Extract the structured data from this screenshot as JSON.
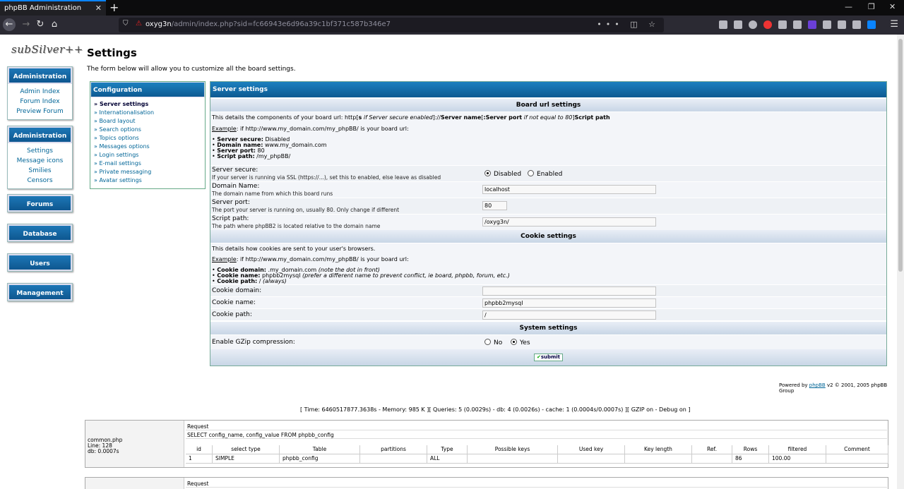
{
  "browser": {
    "tab_title": "phpBB Administration",
    "url_host": "oxyg3n",
    "url_path": "/admin/index.php?sid=fc66943e6d96a39c1bf371c587b346e7",
    "tab_close": "✕",
    "new_tab": "+",
    "win_min": "—",
    "win_restore": "❐",
    "win_close": "✕",
    "more_dots": "•••"
  },
  "logo_text": "subSilver++",
  "nav": {
    "admin1": {
      "title": "Administration",
      "links": [
        "Admin Index",
        "Forum Index",
        "Preview Forum"
      ]
    },
    "admin2": {
      "title": "Administration",
      "links": [
        "Settings",
        "Message icons",
        "Smilies",
        "Censors"
      ]
    },
    "forums": "Forums",
    "database": "Database",
    "users": "Users",
    "management": "Management"
  },
  "page": {
    "title": "Settings",
    "intro": "The form below will allow you to customize all the board settings."
  },
  "config": {
    "title": "Configuration",
    "items": [
      "» Server settings",
      "» Internationalisation",
      "» Board layout",
      "» Search options",
      "» Topics options",
      "» Messages options",
      "» Login settings",
      "» E-mail settings",
      "» Private messaging",
      "» Avatar settings"
    ]
  },
  "server": {
    "title": "Server settings",
    "board_url_header": "Board url settings",
    "board_desc_1": "This details the components of your board url: http[",
    "board_desc_s": "s",
    "board_desc_if": " if Server secure enabled",
    "board_desc_2": "]://",
    "board_desc_sn": "Server name",
    "board_desc_3": "[",
    "board_desc_sp": ":Server port",
    "board_desc_if2": " if not equal to 80",
    "board_desc_4": "]",
    "board_desc_path": "Script path",
    "example_label": "Example",
    "example_text": ": if http://www.my_domain.com/my_phpBB/ is your board url:",
    "bullets": [
      {
        "k": "Server secure:",
        "v": " Disabled"
      },
      {
        "k": "Domain name:",
        "v": " www.my_domain.com"
      },
      {
        "k": "Server port:",
        "v": " 80"
      },
      {
        "k": "Script path:",
        "v": " /my_phpBB/"
      }
    ],
    "secure_label": "Server secure:",
    "secure_sub": "If your server is running via SSL (https://...), set this to enabled, else leave as disabled",
    "secure_opt1": "Disabled",
    "secure_opt2": "Enabled",
    "domain_label": "Domain Name:",
    "domain_sub": "The domain name from which this board runs",
    "domain_value": "localhost",
    "port_label": "Server port:",
    "port_sub": "The port your server is running on, usually 80. Only change if different",
    "port_value": "80",
    "path_label": "Script path:",
    "path_sub": "The path where phpBB2 is located relative to the domain name",
    "path_value": "/oxyg3n/"
  },
  "cookie": {
    "header": "Cookie settings",
    "desc": "This details how cookies are sent to your user's browsers.",
    "example_label": "Example",
    "example_text": ": if http://www.my_domain.com/my_phpBB/ is your board url:",
    "bullets": [
      {
        "k": "Cookie domain:",
        "v": " .my_domain.com",
        "note": " (note the dot in front)"
      },
      {
        "k": "Cookie name:",
        "v": " phpbb2mysql",
        "note": " (prefer a different name to prevent conflict, ie board, phpbb, forum, etc.)"
      },
      {
        "k": "Cookie path:",
        "v": " / ",
        "note": "(always)"
      }
    ],
    "domain_label": "Cookie domain:",
    "domain_value": "",
    "name_label": "Cookie name:",
    "name_value": "phpbb2mysql",
    "path_label": "Cookie path:",
    "path_value": "/"
  },
  "system": {
    "header": "System settings",
    "gzip_label": "Enable GZip compression:",
    "opt_no": "No",
    "opt_yes": "Yes"
  },
  "submit_label": "submit",
  "footer": {
    "powered_pre": "Powered by ",
    "powered_link": "phpBB",
    "powered_post": " v2 © 2001, 2005 phpBB Group",
    "debug": "[ Time: 6460517877.3638s - Memory: 985 K ][ Queries: 5 (0.0029s) - db: 4 (0.0026s) - cache: 1 (0.0004s/0.0007s) ][ GZIP on - Debug on ]"
  },
  "sql": {
    "file": "common.php",
    "line": "Line: 128",
    "db": "db: 0.0007s",
    "request_label": "Request",
    "query": "SELECT config_name, config_value FROM phpbb_config",
    "columns": [
      "id",
      "select type",
      "Table",
      "partitions",
      "Type",
      "Possible keys",
      "Used key",
      "Key length",
      "Ref.",
      "Rows",
      "filtered",
      "Comment"
    ],
    "row": [
      "1",
      "SIMPLE",
      "phpbb_config",
      "",
      "ALL",
      "",
      "",
      "",
      "",
      "86",
      "100.00",
      ""
    ],
    "request_label2": "Request"
  }
}
